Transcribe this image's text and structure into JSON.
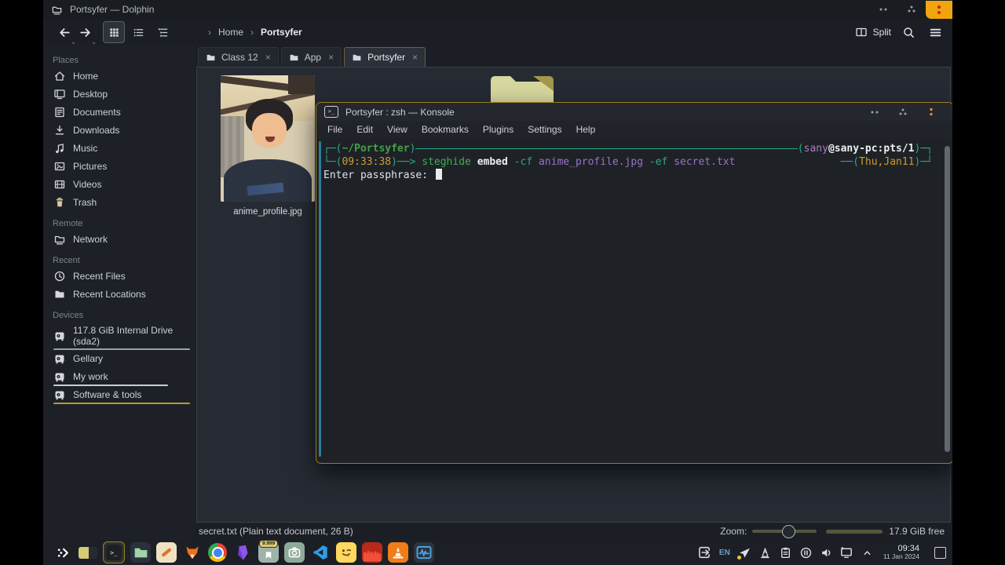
{
  "dolphin": {
    "title": "Portsyfer — Dolphin",
    "breadcrumb": {
      "sep": "›",
      "items": [
        "Home",
        "Portsyfer"
      ]
    },
    "toolbar": {
      "split": "Split"
    },
    "tab_close": "×",
    "tabs": [
      {
        "label": "Class 12"
      },
      {
        "label": "App"
      },
      {
        "label": "Portsyfer"
      }
    ],
    "sidebar": {
      "sections": [
        {
          "label": "Places",
          "items": [
            {
              "label": "Home",
              "icon": "home-icon"
            },
            {
              "label": "Desktop",
              "icon": "desktop-icon"
            },
            {
              "label": "Documents",
              "icon": "document-icon"
            },
            {
              "label": "Downloads",
              "icon": "download-icon"
            },
            {
              "label": "Music",
              "icon": "music-icon"
            },
            {
              "label": "Pictures",
              "icon": "picture-icon"
            },
            {
              "label": "Videos",
              "icon": "video-icon"
            },
            {
              "label": "Trash",
              "icon": "trash-icon"
            }
          ]
        },
        {
          "label": "Remote",
          "items": [
            {
              "label": "Network",
              "icon": "network-icon"
            }
          ]
        },
        {
          "label": "Recent",
          "items": [
            {
              "label": "Recent Files",
              "icon": "clock-icon"
            },
            {
              "label": "Recent Locations",
              "icon": "folder-icon"
            }
          ]
        },
        {
          "label": "Devices",
          "items": [
            {
              "label": "117.8 GiB Internal Drive (sda2)",
              "icon": "drive-icon"
            },
            {
              "label": "Gellary",
              "icon": "drive-icon"
            },
            {
              "label": "My work",
              "icon": "drive-icon"
            },
            {
              "label": "Software & tools",
              "icon": "drive-icon"
            }
          ]
        }
      ]
    },
    "file": {
      "name": "anime_profile.jpg"
    },
    "status": {
      "selection": "secret.txt (Plain text document, 26 B)",
      "zoom_label": "Zoom:",
      "free_space": "17.9 GiB free"
    }
  },
  "konsole": {
    "title": "Portsyfer : zsh — Konsole",
    "menu": [
      "File",
      "Edit",
      "View",
      "Bookmarks",
      "Plugins",
      "Settings",
      "Help"
    ],
    "terminal": {
      "l1_open": "┌─(",
      "cwd": "~/Portsyfer",
      "l1_close": ")",
      "l1_r_open": "(",
      "user": "sany",
      "host": "@sany-pc:pts/1",
      "l1_r_close": ")─┐",
      "l2_open": "└─(",
      "time": "09:33:38",
      "l2_arrow": ")──> ",
      "cmd_1": "steghide ",
      "cmd_2": "embed ",
      "cmd_3": "-cf ",
      "cmd_4": "anime_profile.jpg ",
      "cmd_5": "-ef ",
      "cmd_6": "secret.txt",
      "l2_r_open": "──(",
      "date": "Thu,Jan11",
      "l2_r_close": ")─┘",
      "prompt": "Enter passphrase: "
    }
  },
  "taskbar": {
    "badge_count": "9.999",
    "tray": {
      "lang": "EN"
    },
    "clock": {
      "time": "09:34",
      "date": "11 Jan 2024"
    }
  },
  "colors": {
    "accent_amber": "#f0a50d",
    "konsole_border": "#9a7b1e",
    "terminal_teal": "#2aa889",
    "terminal_purple": "#9d71c9",
    "terminal_yellow": "#d09a2e"
  }
}
